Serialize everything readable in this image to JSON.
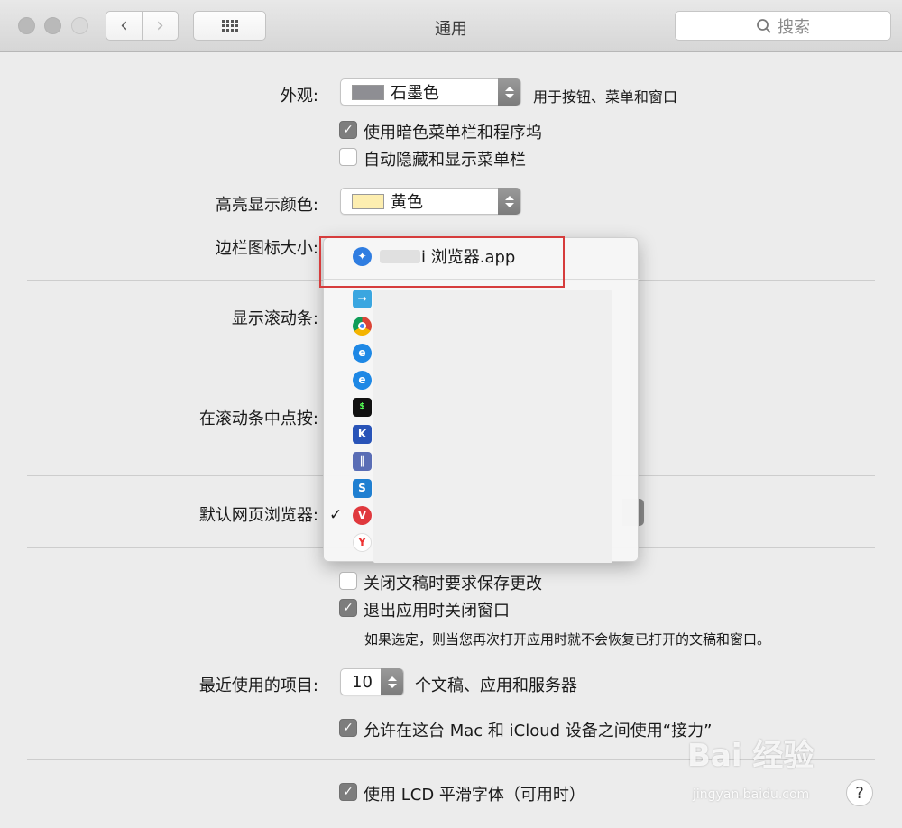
{
  "toolbar": {
    "title": "通用",
    "back_icon": "‹",
    "forward_icon": "›",
    "search_placeholder": "搜索"
  },
  "appearance": {
    "label": "外观:",
    "value": "石墨色",
    "note": "用于按钮、菜单和窗口",
    "swatch_color": "#8e8e93"
  },
  "dark_menu": {
    "label": "使用暗色菜单栏和程序坞",
    "checked": true
  },
  "auto_hide_menu": {
    "label": "自动隐藏和显示菜单栏",
    "checked": false
  },
  "highlight": {
    "label": "高亮显示颜色:",
    "value": "黄色",
    "swatch_color": "#fdeeb0"
  },
  "sidebar_icon": {
    "label": "边栏图标大小:"
  },
  "scrollbars": {
    "label": "显示滚动条:"
  },
  "scroll_click": {
    "label": "在滚动条中点按:"
  },
  "default_browser": {
    "label": "默认网页浏览器:"
  },
  "menu": {
    "selected_item": "i 浏览器.app",
    "checked_mark": "✓",
    "icons": [
      "compass-icon",
      "arrow-app-icon",
      "chrome-icon",
      "ie-icon",
      "ie-icon",
      "terminal-icon",
      "k-app-icon",
      "parallels-icon",
      "s-app-icon",
      "vivaldi-icon",
      "yandex-icon"
    ]
  },
  "ask_save": {
    "label": "关闭文稿时要求保存更改",
    "checked": false
  },
  "close_windows": {
    "label": "退出应用时关闭窗口",
    "checked": true
  },
  "close_windows_note": "如果选定，则当您再次打开应用时就不会恢复已打开的文稿和窗口。",
  "recent": {
    "label": "最近使用的项目:",
    "value": "10",
    "note": "个文稿、应用和服务器"
  },
  "handoff": {
    "label": "允许在这台 Mac 和 iCloud 设备之间使用“接力”",
    "checked": true
  },
  "lcd": {
    "label": "使用 LCD 平滑字体（可用时）",
    "checked": true
  },
  "help": "?",
  "watermark": {
    "brand": "Bai 经验",
    "url": "jingyan.baidu.com"
  }
}
